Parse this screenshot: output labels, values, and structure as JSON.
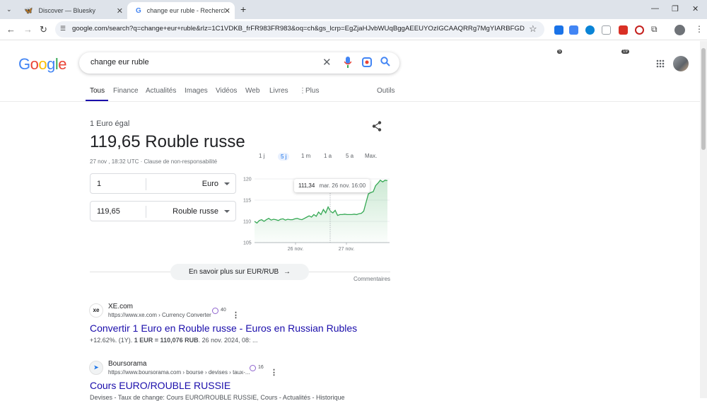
{
  "browser": {
    "tabs": [
      {
        "title": "Discover — Bluesky",
        "icon": "butterfly-icon",
        "active": false
      },
      {
        "title": "change eur ruble - Recherche G",
        "icon": "google-g-icon",
        "active": true
      }
    ],
    "new_tab_label": "+",
    "url": "google.com/search?q=change+eur+ruble&rlz=1C1VDKB_frFR983FR983&oq=ch&gs_lcrp=EgZjaHJvbWUqBggAEEUYOzIGCAAQRRg7MgYIARBFGDsyBggCEE...",
    "extensions": [
      {
        "name": "ext-1",
        "badge": "5",
        "color": "#1a73e8"
      },
      {
        "name": "ext-translate",
        "badge": "",
        "color": "#4285f4"
      },
      {
        "name": "ext-skype",
        "badge": "",
        "color": "#0a84d6"
      },
      {
        "name": "ext-shield",
        "badge": "",
        "color": "#9aa0a6"
      },
      {
        "name": "ext-adblock",
        "badge": "19",
        "color": "#d93025"
      },
      {
        "name": "ext-record",
        "badge": "",
        "color": "#c5221f"
      },
      {
        "name": "ext-puzzle",
        "badge": "",
        "color": "#5f6368"
      }
    ]
  },
  "google": {
    "logo": [
      "G",
      "o",
      "o",
      "g",
      "l",
      "e"
    ],
    "logo_colors": [
      "#4285f4",
      "#ea4335",
      "#fbbc05",
      "#4285f4",
      "#34a853",
      "#ea4335"
    ],
    "query": "change eur ruble",
    "tabs": [
      "Tous",
      "Finance",
      "Actualités",
      "Images",
      "Vidéos",
      "Web",
      "Livres",
      "Plus"
    ],
    "tools": "Outils"
  },
  "converter": {
    "eq_line": "1 Euro égal",
    "rate_text": "119,65 Rouble russe",
    "timestamp": "27 nov , 18:32 UTC · Clause de non-responsabilité",
    "from_amount": "1",
    "from_currency": "Euro",
    "to_amount": "119,65",
    "to_currency": "Rouble russe",
    "ranges": [
      "1 j",
      "5 j",
      "1 m",
      "1 a",
      "5 a",
      "Max."
    ],
    "selected_range": "5 j",
    "tooltip_value": "111,34",
    "tooltip_date": "mar. 26 nov. 16:00",
    "learn_more": "En savoir plus sur EUR/RUB",
    "feedback": "Commentaires"
  },
  "chart_data": {
    "type": "area",
    "y_ticks": [
      "120",
      "115",
      "110",
      "105"
    ],
    "x_ticks": [
      "26 nov.",
      "27 nov."
    ],
    "ylim": [
      105,
      121
    ],
    "color": "#34a853",
    "values": [
      110.0,
      109.6,
      110.2,
      110.4,
      110.0,
      110.4,
      110.7,
      110.3,
      110.5,
      110.4,
      110.2,
      110.5,
      110.6,
      110.3,
      110.5,
      110.4,
      110.4,
      110.6,
      110.7,
      110.5,
      110.4,
      110.7,
      111.0,
      111.3,
      111.0,
      111.6,
      111.2,
      112.2,
      111.6,
      112.8,
      112.0,
      113.4,
      112.4,
      112.0,
      112.6,
      111.4,
      111.6,
      111.6,
      111.7,
      111.6,
      111.6,
      111.6,
      111.7,
      111.6,
      111.8,
      111.9,
      112.4,
      114.5,
      116.5,
      116.8,
      117.0,
      118.4,
      119.0,
      119.7,
      119.3,
      119.7,
      119.6
    ]
  },
  "results": [
    {
      "site": "XE.com",
      "icon_text": "xe",
      "url": "https://www.xe.com › Currency Converter",
      "ring_count": "40",
      "title": "Convertir 1 Euro en Rouble russe - Euros en Russian Rubles",
      "snippet_pre": "+12.62%. (1Y). ",
      "snippet_bold": "1 EUR = 110,076 RUB",
      "snippet_post": ". 26 nov. 2024, 08: ..."
    },
    {
      "site": "Boursorama",
      "icon_text": "➤",
      "url": "https://www.boursorama.com › bourse › devises › taux-...",
      "ring_count": "16",
      "title": "Cours EURO/ROUBLE RUSSIE",
      "snippet_pre": "Devises - Taux de change: Cours EURO/ROUBLE RUSSIE, Cours - Actualités - Historique",
      "snippet_bold": "",
      "snippet_post": ""
    }
  ]
}
